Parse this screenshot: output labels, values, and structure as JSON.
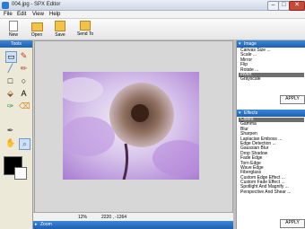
{
  "window": {
    "title": "004.jpg - SPX Editor"
  },
  "menu": [
    "File",
    "Edit",
    "View",
    "Help"
  ],
  "toolbar": [
    {
      "label": "New",
      "icon": "new-document-icon"
    },
    {
      "label": "Open",
      "icon": "open-folder-icon"
    },
    {
      "label": "Save",
      "icon": "save-disk-icon"
    },
    {
      "label": "Send To",
      "icon": "send-to-icon"
    }
  ],
  "tools": {
    "title": "Tools"
  },
  "status": {
    "zoom": "12%",
    "coords": "2220 , -1264"
  },
  "zoombar": {
    "label": "Zoom"
  },
  "image_panel": {
    "title": "Image",
    "items": [
      "Canvas Size ...",
      "Scale ...",
      "Mirror",
      "Flip",
      "Rotate ...",
      "Invert",
      "Grayscale"
    ],
    "selected": 5,
    "apply_label": "APPLY"
  },
  "effects_panel": {
    "title": "Effects",
    "items": [
      "Colors",
      "Gamma",
      "Blur",
      "Sharpen",
      "Laplacian Emboss ...",
      "Edge Detection ...",
      "Gaussian Blur",
      "Drop Shadow",
      "Fade Edge",
      "Torn Edge",
      "Wave Edge",
      "Fiberglass",
      "Custom Edge Effect ...",
      "Custom Fade Effect ...",
      "Spotlight And Magnify ...",
      "Perspective And Shear ..."
    ],
    "selected": 0,
    "apply_label": "APPLY"
  },
  "colors": {
    "foreground": "#000000",
    "background": "#ffffff",
    "accent": "#2a6fc4"
  }
}
